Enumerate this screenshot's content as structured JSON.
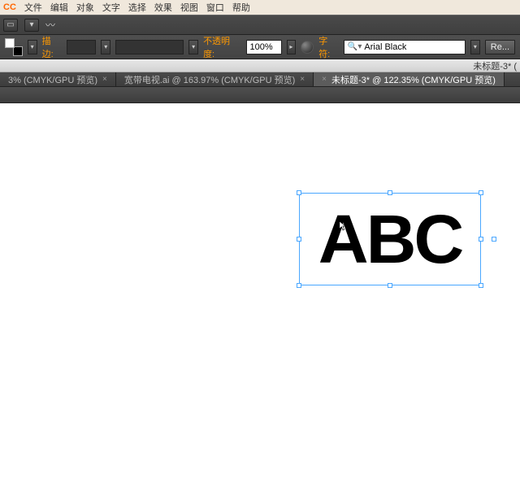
{
  "menu": {
    "app": "CC",
    "items": [
      "文件",
      "编辑",
      "对象",
      "文字",
      "选择",
      "效果",
      "视图",
      "窗口",
      "帮助"
    ]
  },
  "options": {
    "stroke_label": "描边:",
    "stroke_value": "",
    "style_value": "",
    "opacity_label": "不透明度:",
    "opacity_value": "100%",
    "font_label": "字符:",
    "font_value": "Arial Black",
    "reset_label": "Re..."
  },
  "doc_title": "未标题-3* (",
  "tabs": [
    {
      "label": "3% (CMYK/GPU 预览)",
      "active": false
    },
    {
      "label": "宽带电视.ai @ 163.97% (CMYK/GPU 预览)",
      "active": false
    },
    {
      "label": "未标题-3* @ 122.35% (CMYK/GPU 预览)",
      "active": true
    }
  ],
  "artwork_text": "ABC"
}
